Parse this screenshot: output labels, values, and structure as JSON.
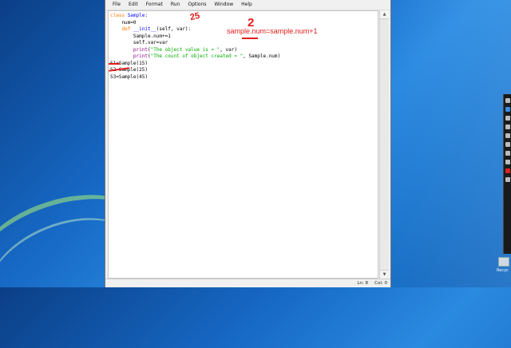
{
  "menu": [
    "File",
    "Edit",
    "Format",
    "Run",
    "Options",
    "Window",
    "Help"
  ],
  "code_lines": [
    [
      [
        "kw",
        "class "
      ],
      [
        "cls",
        "Sample"
      ],
      [
        "",
        ":"
      ]
    ],
    [
      [
        "",
        "    num=0"
      ]
    ],
    [
      [
        "",
        "    "
      ],
      [
        "kw",
        "def "
      ],
      [
        "cls",
        "__init__"
      ],
      [
        "",
        "(self, var):"
      ]
    ],
    [
      [
        "",
        "        Sample.num+=1"
      ]
    ],
    [
      [
        "",
        "        self.var=var"
      ]
    ],
    [
      [
        "",
        "        "
      ],
      [
        "bi",
        "print"
      ],
      [
        "",
        "("
      ],
      [
        "str",
        "\"The object value is = \""
      ],
      [
        "",
        ", var)"
      ]
    ],
    [
      [
        "",
        "        "
      ],
      [
        "bi",
        "print"
      ],
      [
        "",
        "("
      ],
      [
        "str",
        "\"The count of object created = \""
      ],
      [
        "",
        ", Sample.num)"
      ]
    ],
    [
      [
        "",
        "S1=Sample(15)"
      ]
    ],
    [
      [
        "",
        "S2=Sample(25)"
      ]
    ],
    [
      [
        "",
        "S3=Sample(45)"
      ]
    ]
  ],
  "annotations": {
    "formula": "sample.num=sample.num+1",
    "count": "2",
    "value": "25"
  },
  "status": {
    "line": "Ln: 8",
    "col": "Col: 0"
  },
  "desktop": {
    "recycle_label": "Recyc"
  }
}
